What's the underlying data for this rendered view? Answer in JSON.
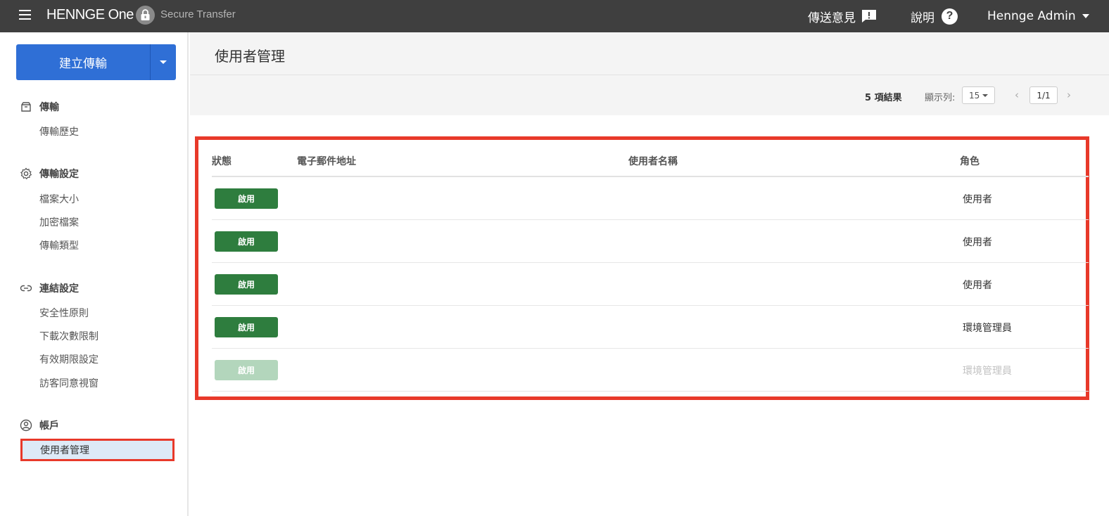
{
  "topbar": {
    "brand": "HENNGE One",
    "product": "Secure Transfer",
    "feedback_label": "傳送意見",
    "help_label": "說明",
    "help_icon_glyph": "?",
    "user_label": "Hennge Admin"
  },
  "sidebar": {
    "create_label": "建立傳輸",
    "sections": [
      {
        "title": "傳輸",
        "icon": "box-icon",
        "items": [
          "傳輸歷史"
        ]
      },
      {
        "title": "傳輸設定",
        "icon": "gear-icon",
        "items": [
          "檔案大小",
          "加密檔案",
          "傳輸類型"
        ]
      },
      {
        "title": "連結設定",
        "icon": "link-icon",
        "items": [
          "安全性原則",
          "下載次數限制",
          "有效期限設定",
          "訪客同意視窗"
        ]
      },
      {
        "title": "帳戶",
        "icon": "user-circle-icon",
        "items": [
          "使用者管理"
        ]
      }
    ],
    "active_item": "使用者管理"
  },
  "main": {
    "title": "使用者管理",
    "results": "5 項結果",
    "rows_label": "顯示列:",
    "rows_per_page": "15",
    "page": "1/1",
    "prev_glyph": "‹",
    "next_glyph": "›"
  },
  "table": {
    "columns": [
      "狀態",
      "電子郵件地址",
      "使用者名稱",
      "角色"
    ],
    "rows": [
      {
        "status": "啟用",
        "email": "",
        "name": "",
        "role": "使用者",
        "dimmed": false
      },
      {
        "status": "啟用",
        "email": "",
        "name": "",
        "role": "使用者",
        "dimmed": false
      },
      {
        "status": "啟用",
        "email": "",
        "name": "",
        "role": "使用者",
        "dimmed": false
      },
      {
        "status": "啟用",
        "email": "",
        "name": "",
        "role": "環境管理員",
        "dimmed": false
      },
      {
        "status": "啟用",
        "email": "",
        "name": "",
        "role": "環境管理員",
        "dimmed": true
      }
    ]
  },
  "colors": {
    "topbar": "#3f3f3f",
    "primary": "#2f6fd6",
    "active_badge": "#2e7d3e",
    "highlight": "#e8392a",
    "active_nav_bg": "#ddeaf7"
  }
}
